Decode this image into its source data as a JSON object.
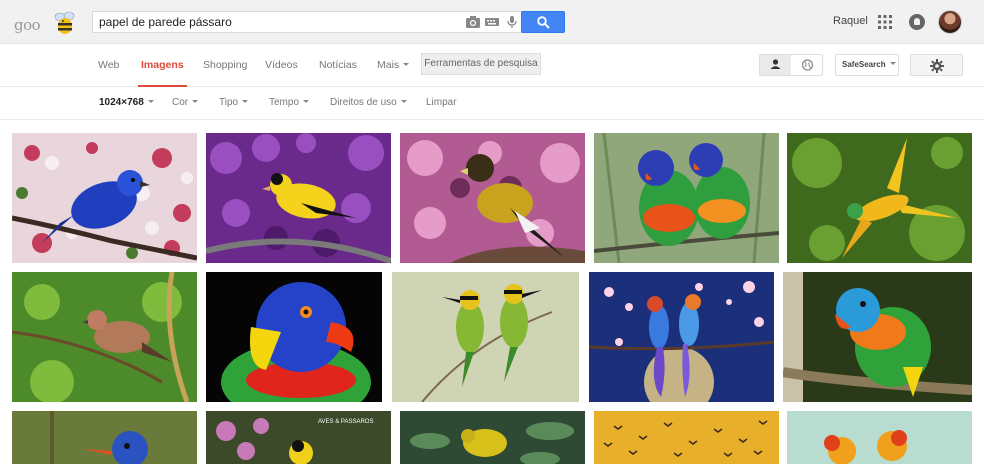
{
  "header": {
    "logo_text": "goo",
    "query": "papel de parede pássaro",
    "user_name": "Raquel"
  },
  "nav": {
    "tabs": [
      {
        "label": "Web",
        "active": false
      },
      {
        "label": "Imagens",
        "active": true
      },
      {
        "label": "Shopping",
        "active": false
      },
      {
        "label": "Vídeos",
        "active": false
      },
      {
        "label": "Notícias",
        "active": false
      },
      {
        "label": "Mais",
        "active": false
      }
    ],
    "tools_label": "Ferramentas de pesquisa",
    "safesearch_label": "SafeSearch"
  },
  "filters": [
    {
      "label": "1024×768",
      "selected": true
    },
    {
      "label": "Cor",
      "selected": false
    },
    {
      "label": "Tipo",
      "selected": false
    },
    {
      "label": "Tempo",
      "selected": false
    },
    {
      "label": "Direitos de uso",
      "selected": false
    },
    {
      "label": "Limpar",
      "selected": false
    }
  ],
  "results": {
    "rows": [
      [
        "bluebird-cherry-blossoms",
        "goldfinch-purple-flowers",
        "evening-grosbeak-pink-flowers",
        "two-rainbow-lorikeets",
        "yellow-parrot-flying"
      ],
      [
        "sparrow-on-branch",
        "rainbow-lorikeet-closeup",
        "two-bee-eaters",
        "two-painted-birds-art",
        "lorikeet-on-branch"
      ],
      [
        "kingfisher-on-branch",
        "bird-with-flowers",
        "yellow-bird-in-leaves",
        "flock-at-sunset",
        "two-orange-parrots"
      ]
    ],
    "watermark_text": "AVES & PASSAROS"
  },
  "colors": {
    "accent_red": "#dd4b39",
    "search_blue": "#4285f4",
    "header_gray": "#f1f1f1"
  }
}
